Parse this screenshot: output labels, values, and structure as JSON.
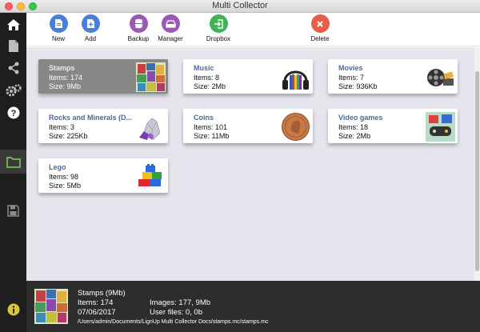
{
  "window": {
    "title": "Multi Collector"
  },
  "toolbar": {
    "buttons": [
      {
        "label": "New",
        "icon": "new-document-icon",
        "color": "#4a7fd8"
      },
      {
        "label": "Add",
        "icon": "add-document-icon",
        "color": "#4a7fd8"
      },
      {
        "label": "Backup",
        "icon": "database-icon",
        "color": "#9b59b6"
      },
      {
        "label": "Manager",
        "icon": "drive-icon",
        "color": "#9b59b6"
      },
      {
        "label": "Dropbox",
        "icon": "exit-icon",
        "color": "#3fb356"
      },
      {
        "label": "Delete",
        "icon": "delete-icon",
        "color": "#e85c4a"
      }
    ]
  },
  "sidebar": {
    "items": [
      {
        "icon": "home-icon"
      },
      {
        "icon": "document-icon"
      },
      {
        "icon": "share-icon"
      },
      {
        "icon": "gears-icon"
      },
      {
        "icon": "help-icon"
      },
      {
        "icon": "folder-icon",
        "active": true
      },
      {
        "icon": "save-icon"
      },
      {
        "icon": "info-icon"
      }
    ]
  },
  "collections": [
    {
      "name": "Stamps",
      "items": "Items: 174",
      "size": "Size: 9Mb",
      "selected": true,
      "thumb": "stamps"
    },
    {
      "name": "Music",
      "items": "Items: 8",
      "size": "Size: 2Mb",
      "thumb": "headphones"
    },
    {
      "name": "Movies",
      "items": "Items: 7",
      "size": "Size: 936Kb",
      "thumb": "film"
    },
    {
      "name": "Rocks and Minerals (D...",
      "items": "Items: 3",
      "size": "Size: 225Kb",
      "thumb": "crystal"
    },
    {
      "name": "Coins",
      "items": "Items: 101",
      "size": "Size: 11Mb",
      "thumb": "penny"
    },
    {
      "name": "Video games",
      "items": "Items: 18",
      "size": "Size: 2Mb",
      "thumb": "games"
    },
    {
      "name": "Lego",
      "items": "Items: 98",
      "size": "Size: 5Mb",
      "thumb": "lego"
    }
  ],
  "info": {
    "title": "Stamps (9Mb)",
    "items": "Items: 174",
    "date": "07/06/2017",
    "images": "Images: 177,  9Mb",
    "user_files": "User files: 0,  0b",
    "path": "/Users/admin/Documents/LignUp Multi Collector Docs/stamps.mc/stamps.mc"
  }
}
